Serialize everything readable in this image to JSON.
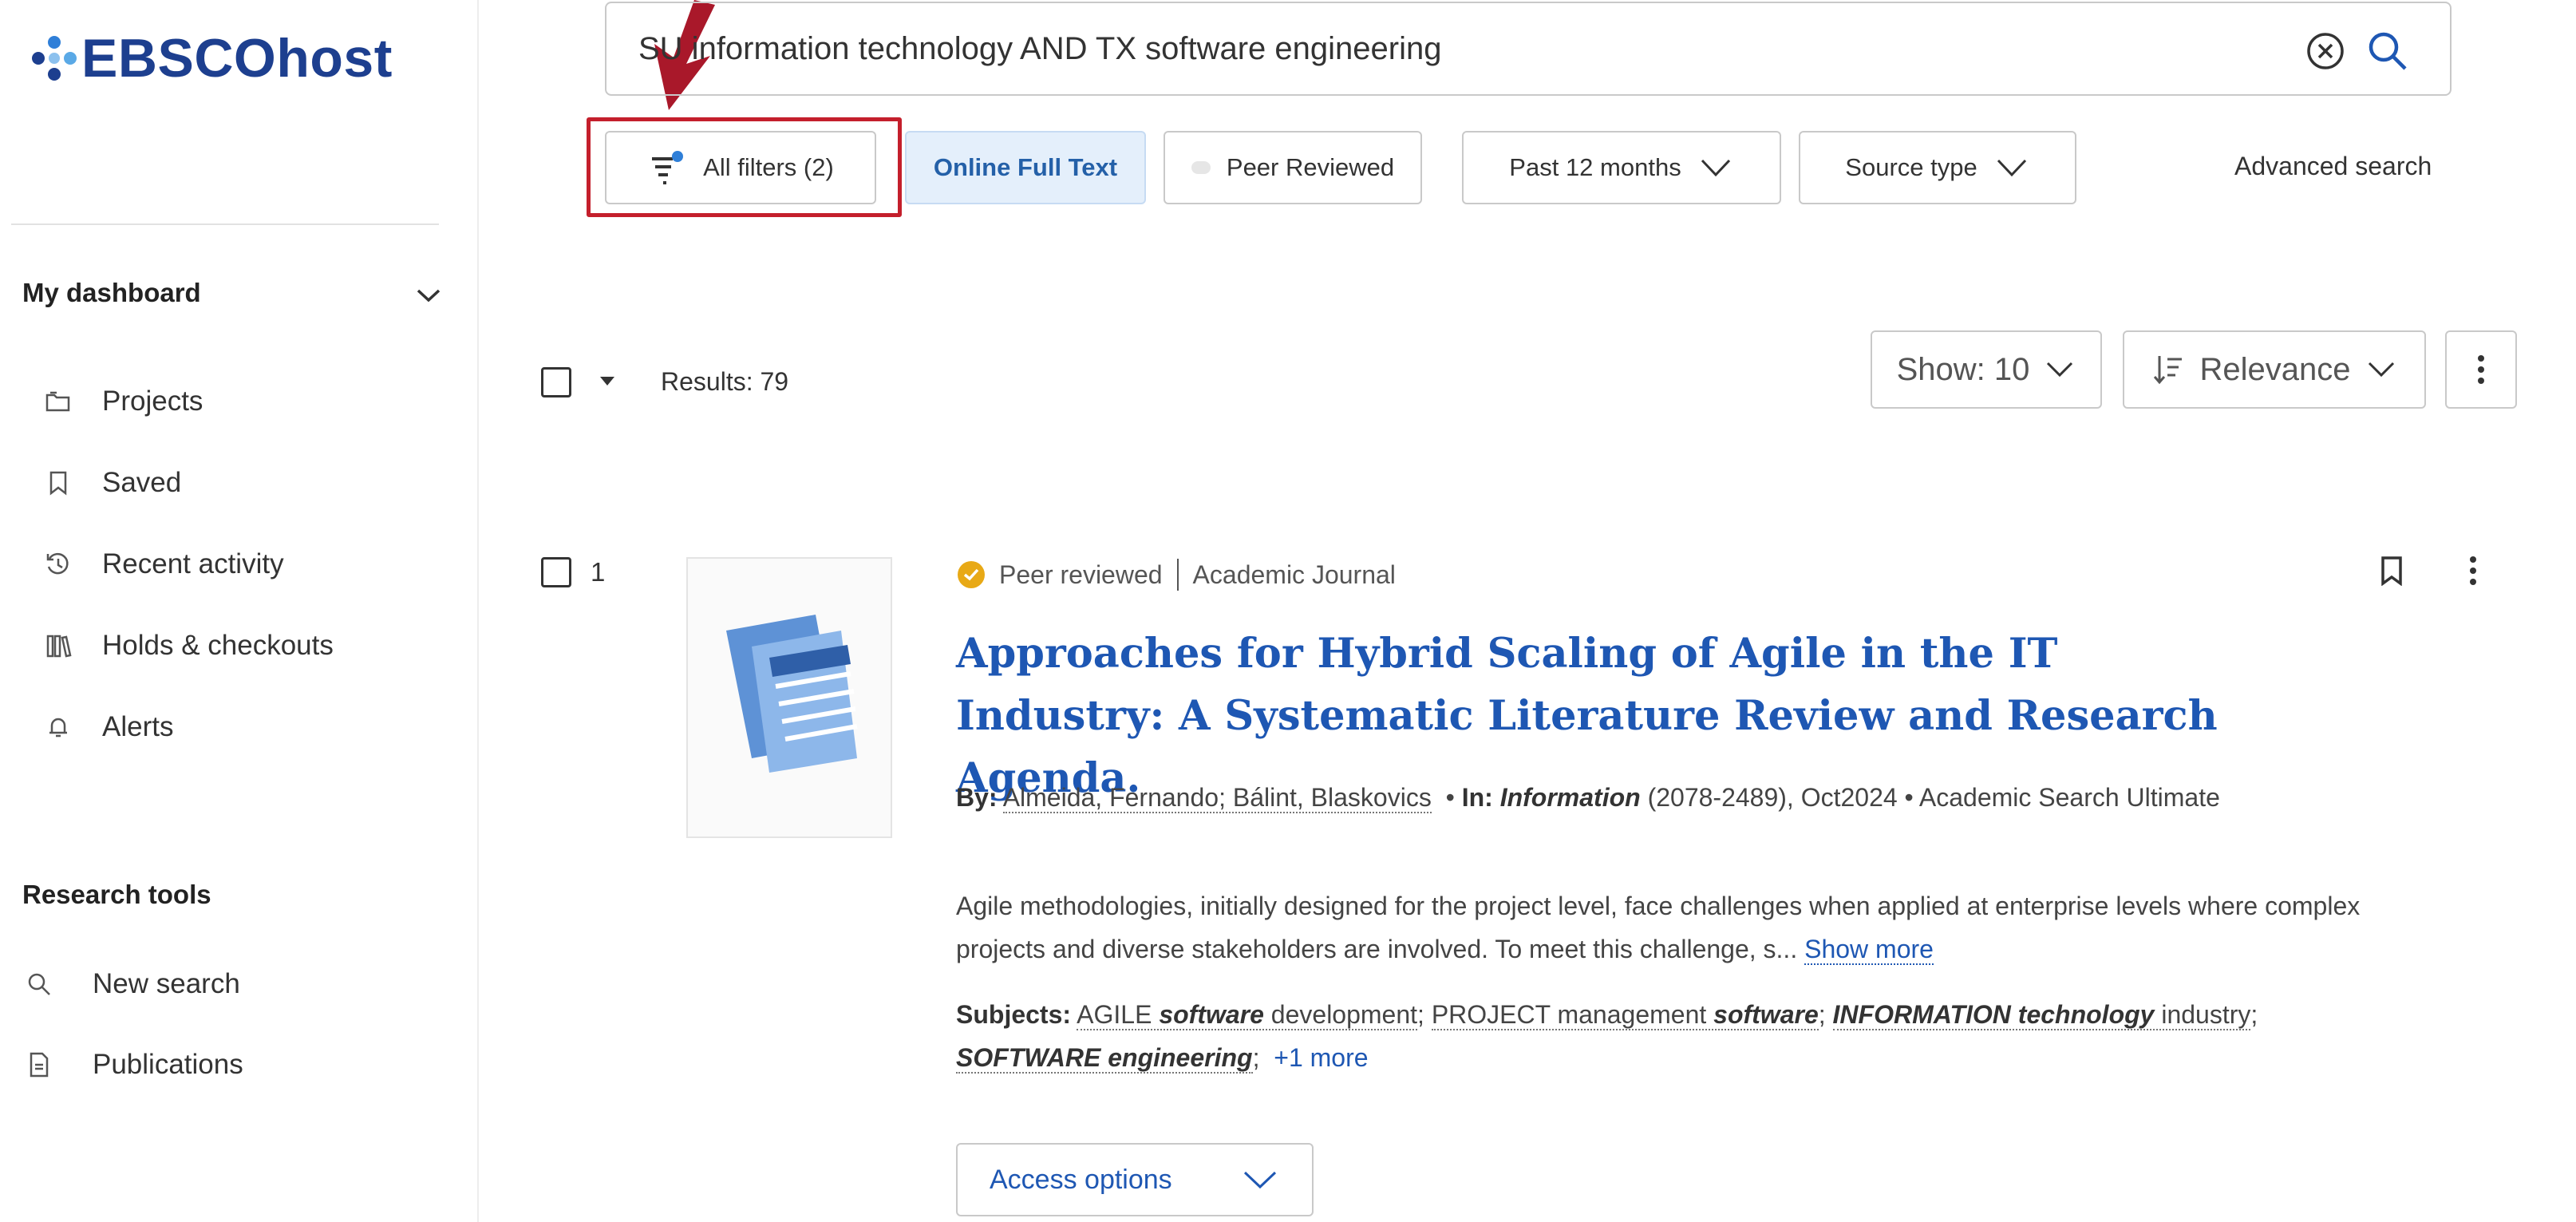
{
  "brand": {
    "name": "EBSCOhost",
    "colors": {
      "primary": "#1d3f8f",
      "accent": "#2f7fd8",
      "highlight": "#c41f2c",
      "link": "#1e57b3"
    }
  },
  "search": {
    "query": "SU information technology AND TX software engineering"
  },
  "filters": {
    "all_filters": "All filters (2)",
    "online_full_text": "Online Full Text",
    "peer_reviewed": "Peer Reviewed",
    "date_range": "Past 12 months",
    "source_type": "Source type",
    "advanced": "Advanced search"
  },
  "sidebar": {
    "dashboard_heading": "My dashboard",
    "dashboard_items": [
      {
        "label": "Projects",
        "icon": "folder-icon"
      },
      {
        "label": "Saved",
        "icon": "bookmark-icon"
      },
      {
        "label": "Recent activity",
        "icon": "history-icon"
      },
      {
        "label": "Holds & checkouts",
        "icon": "books-icon"
      },
      {
        "label": "Alerts",
        "icon": "bell-icon"
      }
    ],
    "tools_heading": "Research tools",
    "tools_items": [
      {
        "label": "New search",
        "icon": "search-icon"
      },
      {
        "label": "Publications",
        "icon": "document-icon"
      }
    ]
  },
  "results": {
    "count_label": "Results: 79",
    "show": "Show: 10",
    "sort": "Relevance"
  },
  "result": {
    "number": "1",
    "peer_label": "Peer reviewed",
    "type": "Academic Journal",
    "title": "Approaches for Hybrid Scaling of Agile in the IT Industry: A Systematic Literature Review and Research Agenda.",
    "by_label": "By:",
    "authors": "Almeida, Fernando; Bálint, Blaskovics",
    "in_label": "In:",
    "journal": "Information",
    "source_rest": "(2078-2489), Oct2024 • Academic Search Ultimate",
    "abstract": "Agile methodologies, initially designed for the project level, face challenges when applied at enterprise levels where complex projects and diverse stakeholders are involved. To meet this challenge, s...",
    "show_more": "Show more",
    "subjects_label": "Subjects:",
    "subjects": [
      {
        "plain": "AGILE ",
        "emph": "software",
        "rest": " development"
      },
      {
        "plain": "PROJECT management ",
        "emph": "software",
        "rest": ""
      },
      {
        "plain": "",
        "emph": "INFORMATION technology",
        "rest": " industry"
      },
      {
        "plain": "",
        "emph": "SOFTWARE engineering",
        "rest": ""
      }
    ],
    "more_subjects": "+1 more",
    "access": "Access options"
  }
}
